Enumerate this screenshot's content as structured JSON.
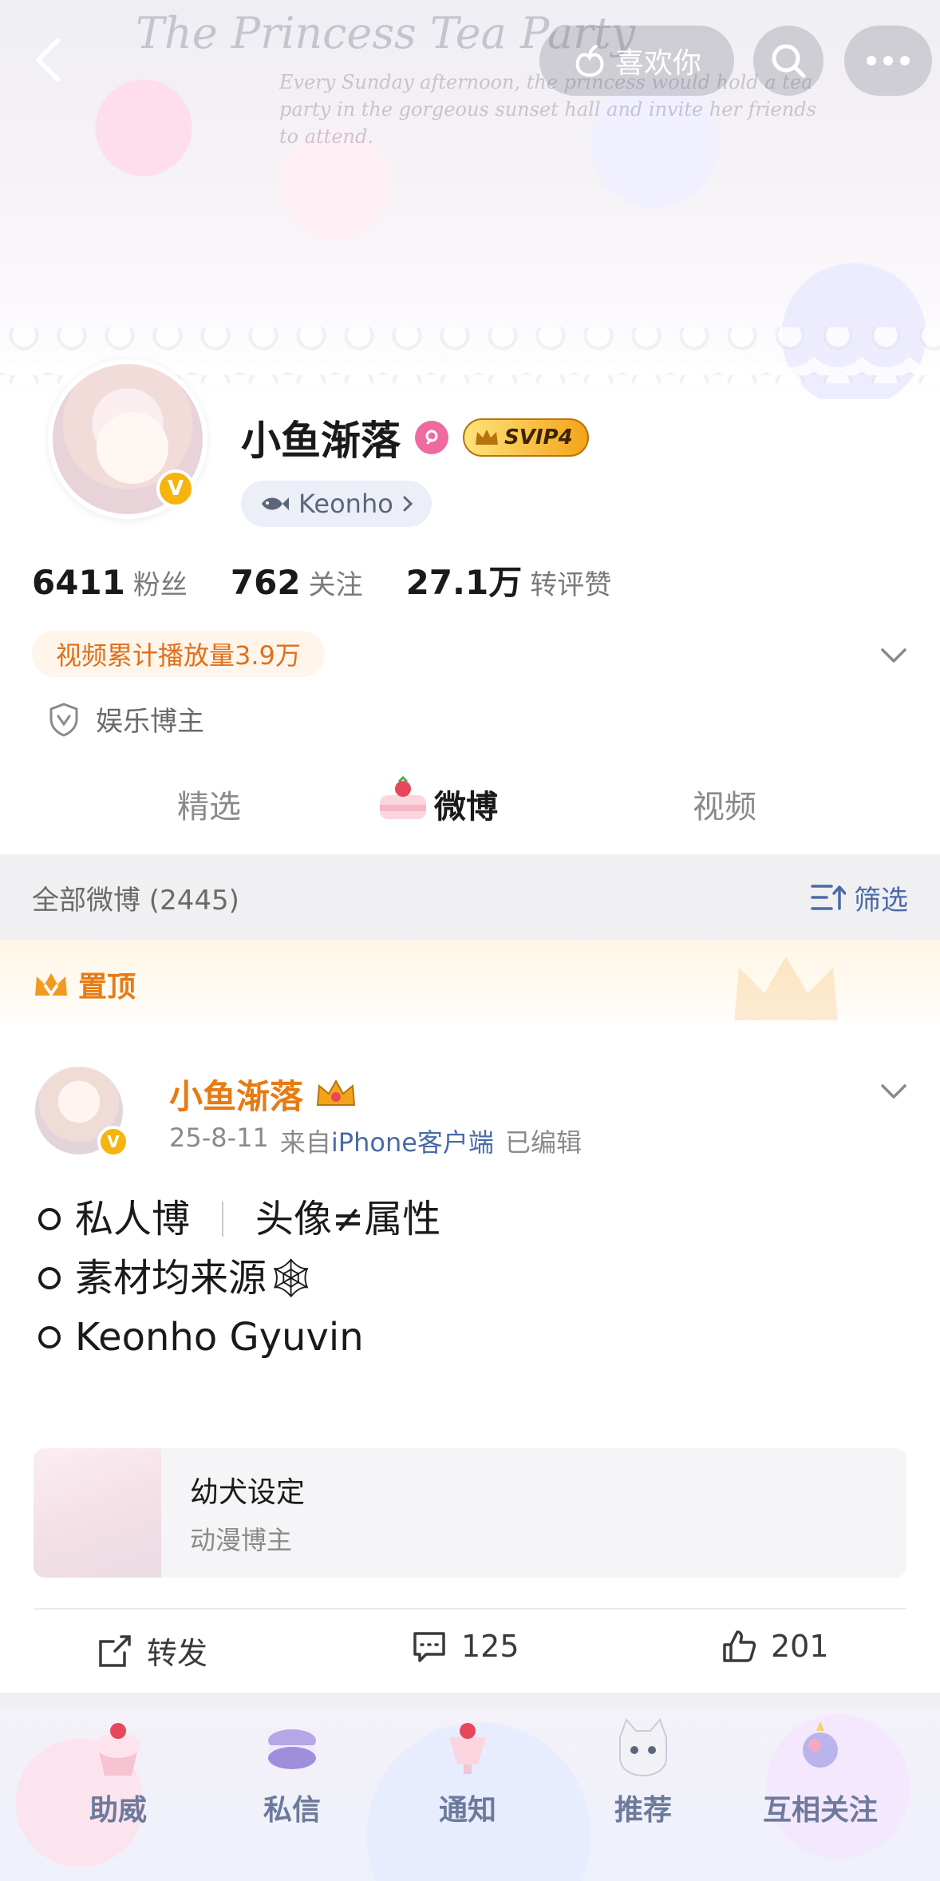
{
  "header": {
    "back_label": "",
    "like_label": "喜欢你",
    "banner_title": "The Princess Tea Party",
    "banner_caption": "Every Sunday afternoon, the princess would hold a tea party in the gorgeous sunset hall and invite her friends to attend."
  },
  "profile": {
    "name": "小鱼渐落",
    "vip_label": "SVIP4",
    "fan_tag": "Keonho",
    "stats": [
      {
        "value": "6411",
        "label": "粉丝"
      },
      {
        "value": "762",
        "label": "关注"
      },
      {
        "value": "27.1万",
        "label": "转评赞"
      }
    ],
    "play_count": "视频累计播放量3.9万",
    "category": "娱乐博主"
  },
  "tabs": [
    {
      "label": "精选",
      "active": false
    },
    {
      "label": "微博",
      "active": true
    },
    {
      "label": "视频",
      "active": false
    }
  ],
  "filter": {
    "count_label": "全部微博 (2445)",
    "filter_label": "筛选"
  },
  "pinned": {
    "label": "置顶"
  },
  "post": {
    "author": "小鱼渐落",
    "date": "25-8-11",
    "from_prefix": "来自",
    "source": "iPhone客户端",
    "edited": "已编辑",
    "lines": [
      {
        "a": "私人博",
        "b": "头像≠属性"
      },
      {
        "a": "素材均来源🕸",
        "b": ""
      },
      {
        "a": "Keonho Gyuvin",
        "b": ""
      }
    ],
    "card": {
      "title": "幼犬设定",
      "subtitle": "动漫博主"
    },
    "actions": {
      "repost": "转发",
      "comments": "125",
      "likes": "201"
    }
  },
  "bottom_nav": [
    {
      "label": "助威",
      "icon": "cupcake-icon"
    },
    {
      "label": "私信",
      "icon": "macaron-icon"
    },
    {
      "label": "通知",
      "icon": "parfait-icon"
    },
    {
      "label": "推荐",
      "icon": "kitten-icon"
    },
    {
      "label": "互相关注",
      "icon": "candy-icon"
    }
  ],
  "colors": {
    "accent_orange": "#e77a12",
    "link_blue": "#4a6aa8",
    "vip_gold": "#f4a41a",
    "verified_yellow": "#f6b40f"
  }
}
